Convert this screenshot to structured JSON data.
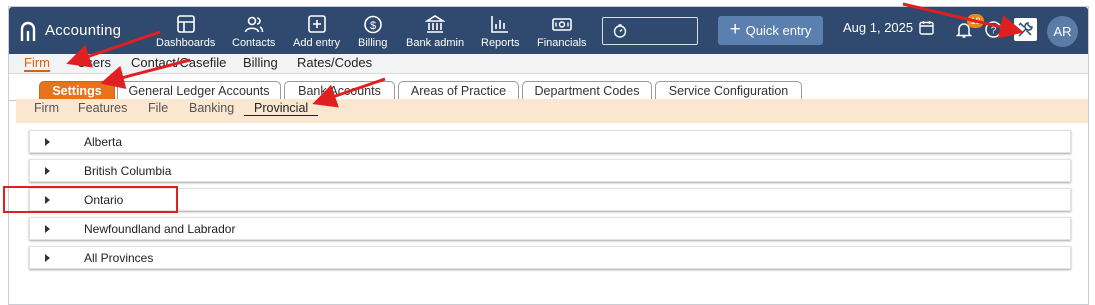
{
  "app": {
    "title": "Accounting"
  },
  "nav": [
    {
      "label": "Dashboards",
      "icon": "dashboard-icon"
    },
    {
      "label": "Contacts",
      "icon": "contacts-icon"
    },
    {
      "label": "Add entry",
      "icon": "add-entry-icon"
    },
    {
      "label": "Billing",
      "icon": "billing-icon"
    },
    {
      "label": "Bank admin",
      "icon": "bank-icon"
    },
    {
      "label": "Reports",
      "icon": "reports-icon"
    },
    {
      "label": "Financials",
      "icon": "financials-icon"
    }
  ],
  "toolbar": {
    "quick_entry": "Quick entry",
    "date": "Aug 1, 2025",
    "notifications_count": "18",
    "user_initials": "AR"
  },
  "menu1": {
    "items": [
      "Firm",
      "Users",
      "Contact/Casefile",
      "Billing",
      "Rates/Codes"
    ],
    "active": "Firm"
  },
  "tabs": {
    "items": [
      "Settings",
      "General Ledger Accounts",
      "Bank Accounts",
      "Areas of Practice",
      "Department Codes",
      "Service Configuration"
    ],
    "active": "Settings"
  },
  "subtabs": {
    "items": [
      "Firm",
      "Features",
      "File",
      "Banking",
      "Provincial"
    ],
    "active": "Provincial"
  },
  "provinces": [
    "Alberta",
    "British Columbia",
    "Ontario",
    "Newfoundland and Labrador",
    "All Provinces"
  ],
  "colors": {
    "topbar": "#2f4a6e",
    "accent": "#e8731a",
    "subbar": "#fbe6cf",
    "annotation": "#e02020"
  }
}
